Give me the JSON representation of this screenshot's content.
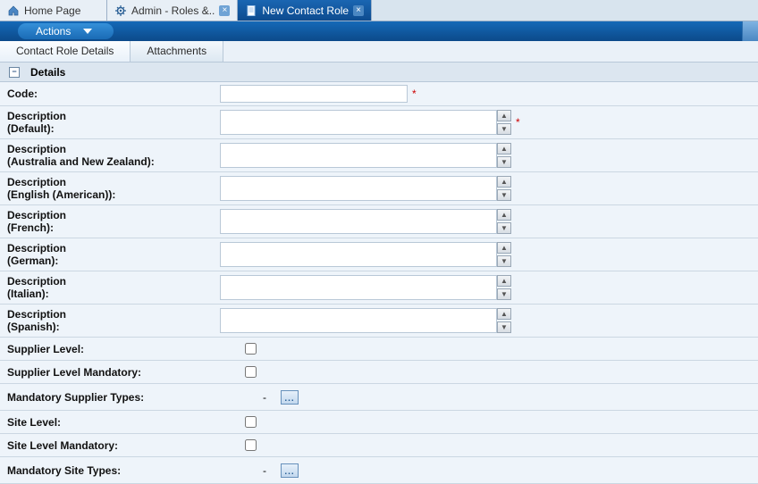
{
  "tabs": [
    {
      "label": "Home Page",
      "icon": "home-icon",
      "closable": false,
      "active": false
    },
    {
      "label": "Admin - Roles &..",
      "icon": "gear-icon",
      "closable": true,
      "active": false
    },
    {
      "label": "New Contact Role",
      "icon": "document-icon",
      "closable": true,
      "active": true
    }
  ],
  "actions": {
    "label": "Actions"
  },
  "subtabs": [
    {
      "label": "Contact Role Details",
      "active": true
    },
    {
      "label": "Attachments",
      "active": false
    }
  ],
  "section": {
    "title": "Details"
  },
  "fields": {
    "code": {
      "label": "Code:",
      "value": "",
      "required": true
    },
    "desc_default": {
      "label": "Description\n(Default):",
      "value": "",
      "required": true
    },
    "desc_anz": {
      "label": "Description\n(Australia and New Zealand):",
      "value": ""
    },
    "desc_en_us": {
      "label": "Description\n(English (American)):",
      "value": ""
    },
    "desc_fr": {
      "label": "Description\n(French):",
      "value": ""
    },
    "desc_de": {
      "label": "Description\n(German):",
      "value": ""
    },
    "desc_it": {
      "label": "Description\n(Italian):",
      "value": ""
    },
    "desc_es": {
      "label": "Description\n(Spanish):",
      "value": ""
    },
    "supplier_level": {
      "label": "Supplier Level:",
      "checked": false
    },
    "supplier_level_mandatory": {
      "label": "Supplier Level Mandatory:",
      "checked": false
    },
    "mandatory_supplier_types": {
      "label": "Mandatory Supplier Types:",
      "value": "-"
    },
    "site_level": {
      "label": "Site Level:",
      "checked": false
    },
    "site_level_mandatory": {
      "label": "Site Level Mandatory:",
      "checked": false
    },
    "mandatory_site_types": {
      "label": "Mandatory Site Types:",
      "value": "-"
    }
  }
}
